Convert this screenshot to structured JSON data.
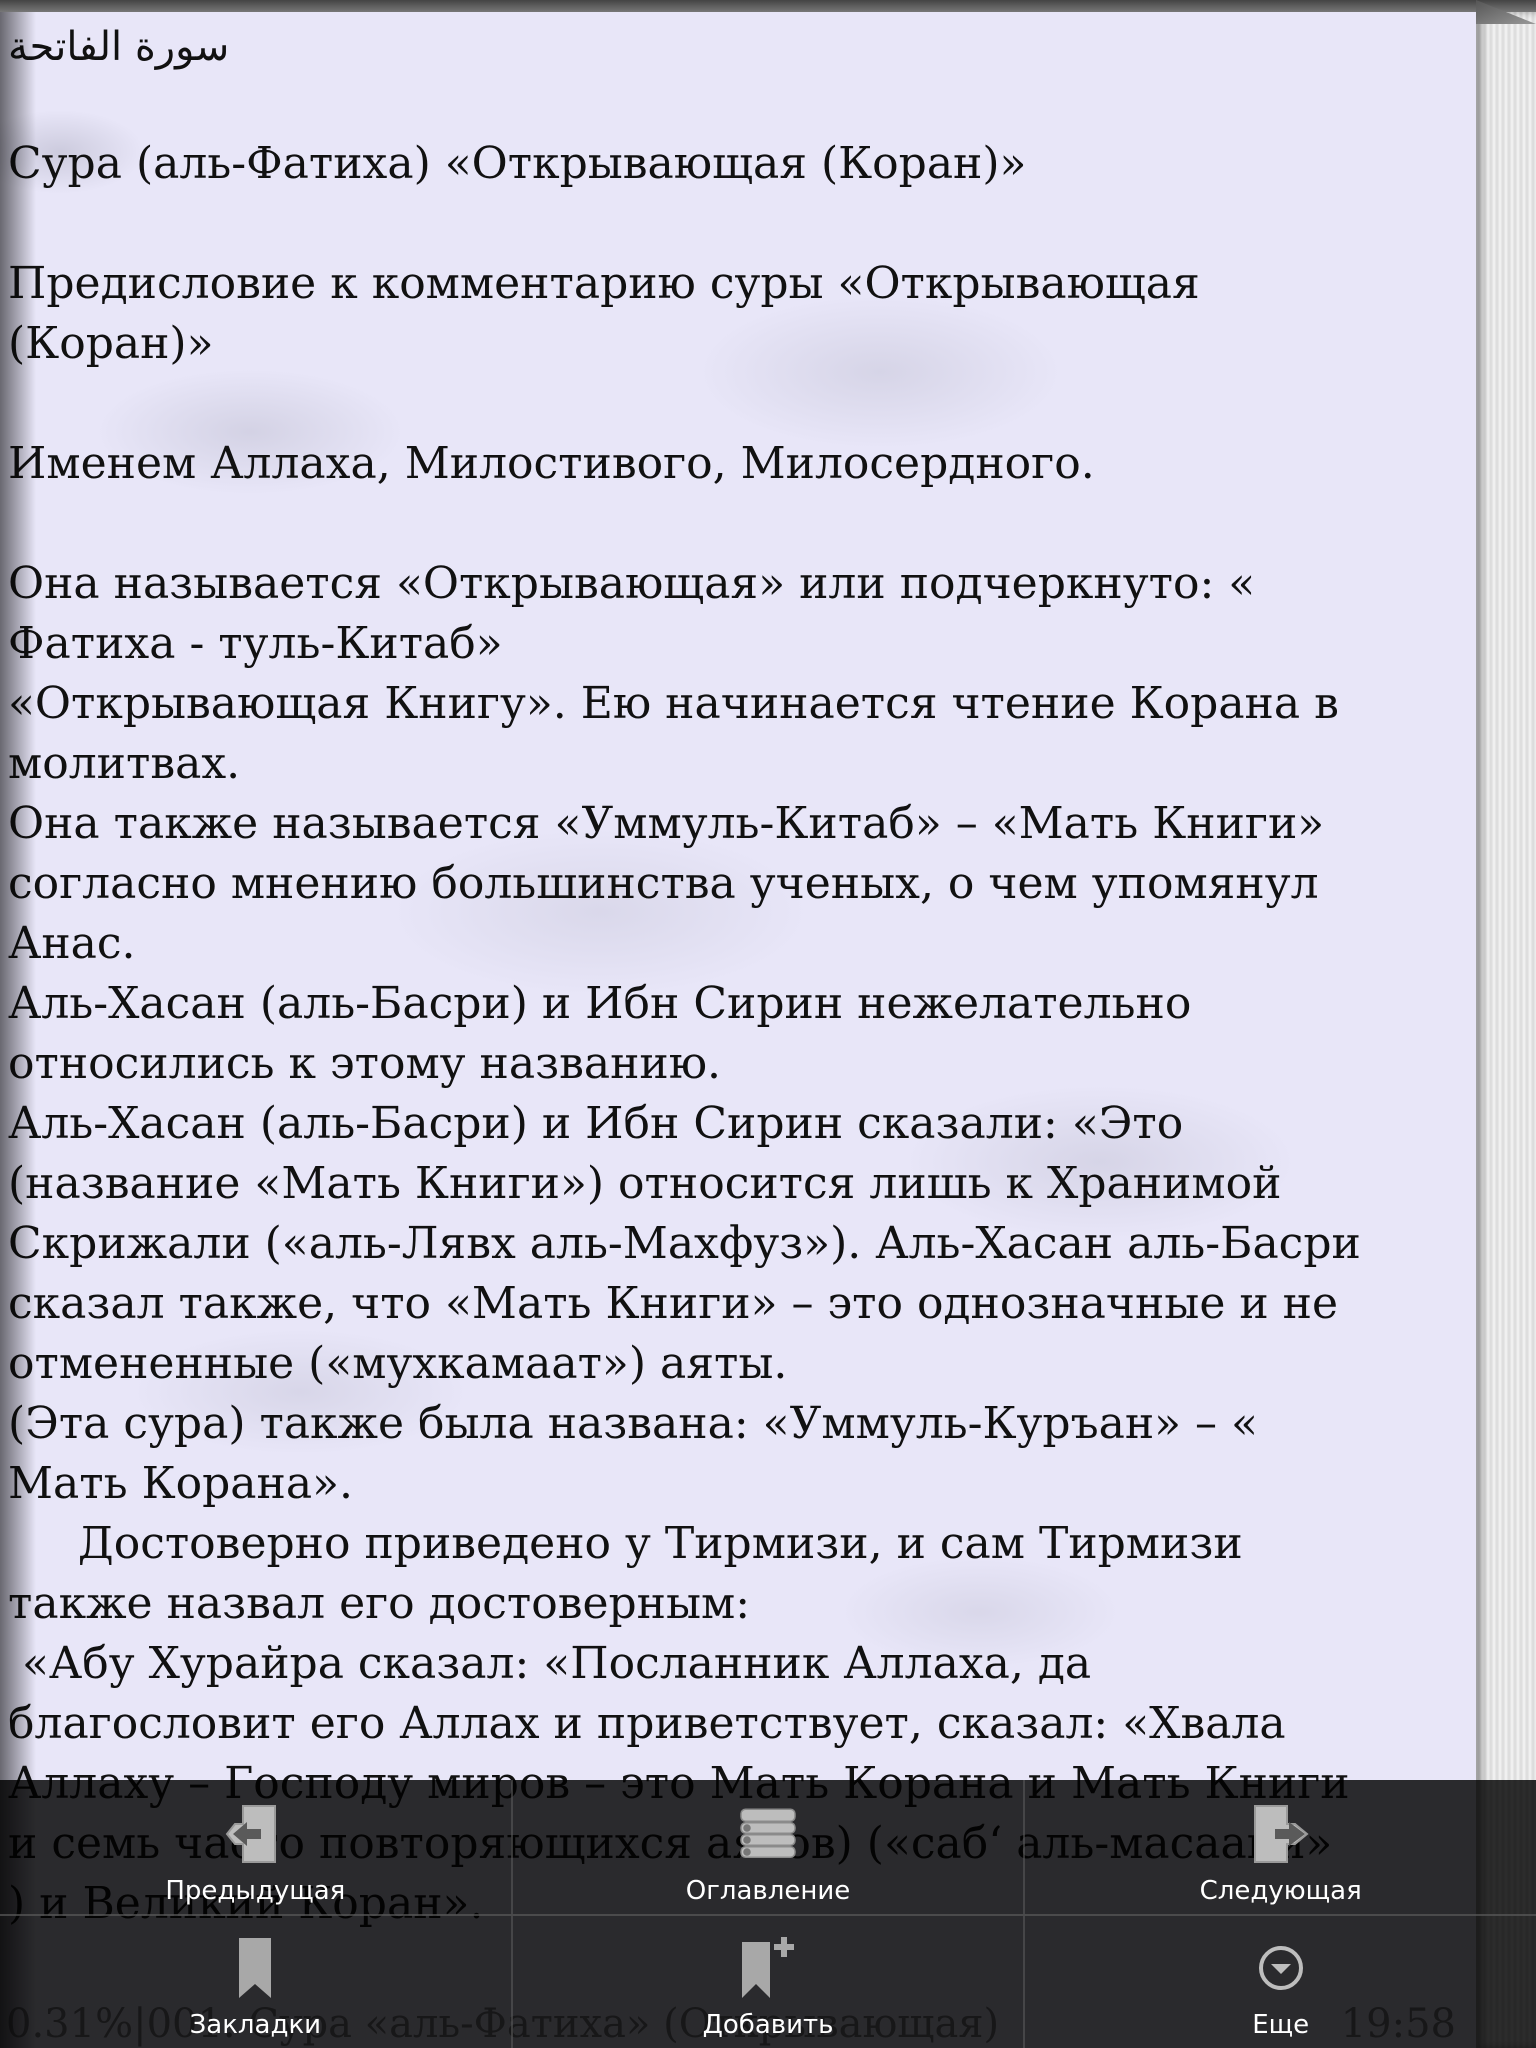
{
  "book": {
    "lines": [
      {
        "type": "arabic",
        "text": "سورة الفاتحة"
      },
      {
        "type": "blank"
      },
      {
        "type": "text",
        "text": "Сура (аль-Фатиха) «Открывающая (Коран)»"
      },
      {
        "type": "blank"
      },
      {
        "type": "text",
        "text": "Предисловие к комментарию суры «Открывающая"
      },
      {
        "type": "text",
        "text": "(Коран)»"
      },
      {
        "type": "blank"
      },
      {
        "type": "text",
        "text": "Именем Аллаха, Милостивого, Милосердного."
      },
      {
        "type": "blank"
      },
      {
        "type": "text",
        "text": "Она называется «Открывающая» или подчеркнуто: «"
      },
      {
        "type": "text",
        "text": "Фатиха - туль-Китаб»"
      },
      {
        "type": "text",
        "text": "«Открывающая Книгу». Ею начинается чтение Корана в"
      },
      {
        "type": "text",
        "text": "молитвах."
      },
      {
        "type": "text",
        "text": "Она также называется «Уммуль-Китаб» – «Мать Книги»"
      },
      {
        "type": "text",
        "text": "согласно мнению большинства ученых, о чем упомянул"
      },
      {
        "type": "text",
        "text": "Анас."
      },
      {
        "type": "text",
        "text": "Аль-Хасан (аль-Басри) и Ибн Сирин нежелательно"
      },
      {
        "type": "text",
        "text": "относились к этому названию."
      },
      {
        "type": "text",
        "text": "Аль-Хасан (аль-Басри) и Ибн Сирин сказали: «Это"
      },
      {
        "type": "text",
        "text": "(название «Мать Книги») относится лишь к Хранимой"
      },
      {
        "type": "text",
        "text": "Скрижали («аль-Лявх аль-Махфуз»). Аль-Хасан аль-Басри"
      },
      {
        "type": "text",
        "text": "сказал также, что «Мать Книги» – это однозначные и не"
      },
      {
        "type": "text",
        "text": "отмененные («мухкамаат») аяты."
      },
      {
        "type": "text",
        "text": "(Эта сура) также была названа: «Уммуль-Куръан» – «"
      },
      {
        "type": "text",
        "text": "Мать Корана»."
      },
      {
        "type": "text",
        "text": "     Достоверно приведено у Тирмизи, и сам Тирмизи"
      },
      {
        "type": "text",
        "text": "также назвал его достоверным:"
      },
      {
        "type": "text",
        "text": " «Абу Хурайра сказал: «Посланник Аллаха, да"
      },
      {
        "type": "text",
        "text": "благословит его Аллах и приветствует, сказал: «Хвала"
      },
      {
        "type": "text",
        "text": "Аллаху – Господу миров – это Мать Корана и Мать Книги"
      },
      {
        "type": "text",
        "text": "и семь часто повторяющихся аятов) («саб‘ аль-масаани»"
      },
      {
        "type": "text",
        "text": ") и Великий Коран»."
      }
    ]
  },
  "menu": {
    "previous_label": "Предыдущая",
    "contents_label": "Оглавление",
    "next_label": "Следующая",
    "bookmarks_label": "Закладки",
    "add_label": "Добавить",
    "more_label": "Еще"
  },
  "status": {
    "progress": "0.31%",
    "chapter": "001. Сура «аль-Фатиха» (Открывающая)",
    "time": "19:58"
  },
  "colors": {
    "paper": "#e8e6f8",
    "menu_bg": "#000000",
    "menu_text": "#ffffff",
    "icon": "#bdbdbd"
  },
  "icons": {
    "previous": "page-back-arrow-icon",
    "contents": "stacked-list-icon",
    "next": "page-forward-arrow-icon",
    "bookmarks": "bookmark-icon",
    "add": "bookmark-plus-icon",
    "more": "chevron-down-circle-icon"
  }
}
